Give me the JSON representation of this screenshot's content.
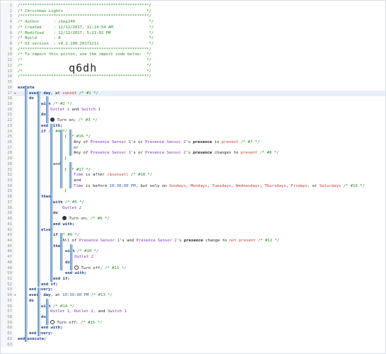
{
  "header": {
    "stars": "/******************************************************/",
    "title": "/* Christmas Lights                                   */",
    "author": "/* Author      : chop249                               */",
    "created": "/* Created     : 12/12/2017, 11:14:54 AM               */",
    "modified": "/* Modified    : 12/12/2017, 5:21:02 PM                */",
    "build": "/* Build       : 8                                     */",
    "ui_version": "/* UI version  : v0.2.100.20171211                     */",
    "import_note": "/* To import this piston, use the import code below:  */",
    "blank": "/*                                                    */",
    "import_code": "q6dh"
  },
  "lines": [
    {
      "no": "1"
    },
    {
      "no": "2"
    },
    {
      "no": "3"
    },
    {
      "no": "4"
    },
    {
      "no": "5"
    },
    {
      "no": "6"
    },
    {
      "no": "7"
    },
    {
      "no": "8"
    },
    {
      "no": "9"
    },
    {
      "no": "10"
    },
    {
      "no": "11"
    },
    {
      "no": "12"
    },
    {
      "no": "13"
    },
    {
      "no": "14"
    },
    {
      "no": "15"
    },
    {
      "no": "16"
    },
    {
      "no": "17"
    },
    {
      "no": "18"
    },
    {
      "no": "19"
    },
    {
      "no": "20"
    },
    {
      "no": "21"
    },
    {
      "no": "22"
    },
    {
      "no": "23"
    },
    {
      "no": "24"
    },
    {
      "no": "25"
    },
    {
      "no": "26"
    },
    {
      "no": "27"
    },
    {
      "no": "28"
    },
    {
      "no": "29"
    },
    {
      "no": "30"
    },
    {
      "no": "31"
    },
    {
      "no": "32"
    },
    {
      "no": "33"
    },
    {
      "no": "34"
    },
    {
      "no": "35"
    },
    {
      "no": "36"
    },
    {
      "no": "37"
    },
    {
      "no": "38"
    },
    {
      "no": "39"
    },
    {
      "no": "40"
    },
    {
      "no": "41"
    },
    {
      "no": "42"
    },
    {
      "no": "43"
    },
    {
      "no": "44"
    },
    {
      "no": "45"
    },
    {
      "no": "46"
    },
    {
      "no": "47"
    },
    {
      "no": "48"
    },
    {
      "no": "49"
    },
    {
      "no": "50"
    },
    {
      "no": "51"
    },
    {
      "no": "52"
    },
    {
      "no": "53"
    },
    {
      "no": "54"
    },
    {
      "no": "55"
    },
    {
      "no": "56"
    },
    {
      "no": "57"
    },
    {
      "no": "58"
    },
    {
      "no": "59"
    },
    {
      "no": "60"
    },
    {
      "no": "61"
    },
    {
      "no": "62"
    },
    {
      "no": "63"
    }
  ],
  "code": {
    "execute": "execute",
    "every_day": "every day",
    "at": ", at ",
    "sunset": "sunset",
    "c1": " /* #1 */",
    "do": "do",
    "with": "with",
    "c2": " /* #2 */",
    "outlet1": "Outlet 1",
    "and": " and ",
    "switch1": "Switch 1",
    "turn_on": " Turn on;",
    "c3": " /* #3 */",
    "end_with": "end with;",
    "if": "if",
    "c4": " /* #4 */",
    "open_paren": "(",
    "c16": " /* #16 */",
    "any_of": "Any of ",
    "ps1": "Presence Sensor 1",
    "or_": "'s or ",
    "ps2": "Presence Sensor 2",
    "s_": "'s ",
    "presence": "presence",
    "is_": " is ",
    "present": "present",
    "c7": " /* #7 */",
    "or": "or",
    "changes_to": " changes to ",
    "c8": " /* #8 */",
    "close_paren": ")",
    "and_kw": "and",
    "c17": " /* #17 */",
    "time": "Time",
    "is_after": " is after ",
    "sunset_v": "($sunset)",
    "c18": " /* #18 */",
    "is_before": " is before ",
    "t2230": "10:30:00 PM",
    "only_on": ", but only on ",
    "days": [
      "Sundays",
      "Mondays",
      "Tuesdays",
      "Wednesdays",
      "Thursdays",
      "Fridays",
      "Saturdays"
    ],
    "comma": ", ",
    "or_sp": ", or ",
    "c19": " /* #19 */",
    "then": "then",
    "c5": " /* #5 */",
    "outlet2": "Outlet 2",
    "c6": " /* #6 */",
    "else": "else",
    "c9": " /* #9 */",
    "all_of": "All of ",
    "and_s": "'s and ",
    "change_to": " change to ",
    "not_present": "not present",
    "c12": " /* #12 */",
    "c10": " /* #10 */",
    "turn_off": " Turn off;",
    "c11": " /* #11 */",
    "end_if": "end if;",
    "end_every": "end every;",
    "c13": " /* #13 */",
    "c14": " /* #14 */",
    "outlets": "Outlet 1, Outlet 2, ",
    "and_word": "and ",
    "c15": " /* #15 */",
    "end_execute": "end execute;"
  }
}
